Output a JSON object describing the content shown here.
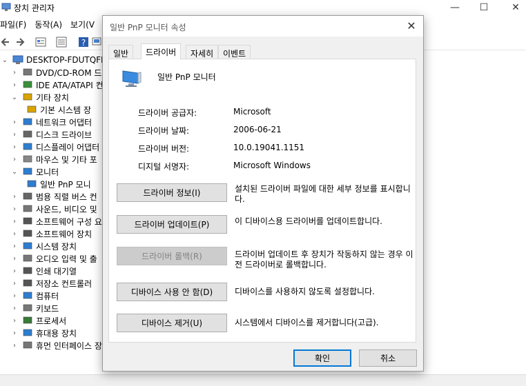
{
  "background_window": {
    "title": "장치 관리자",
    "menu": [
      "파일(F)",
      "동작(A)",
      "보기(V"
    ],
    "tree": {
      "root": "DESKTOP-FDUTQFF",
      "items": [
        {
          "label": "DVD/CD-ROM 드",
          "expanded": false
        },
        {
          "label": "IDE ATA/ATAPI 컨",
          "expanded": false
        },
        {
          "label": "기타 장치",
          "expanded": true
        },
        {
          "label": "기본 시스템 장",
          "child": true
        },
        {
          "label": "네트워크 어댑터",
          "expanded": false
        },
        {
          "label": "디스크 드라이브",
          "expanded": false
        },
        {
          "label": "디스플레이 어댑터",
          "expanded": false
        },
        {
          "label": "마우스 및 기타 포",
          "expanded": false
        },
        {
          "label": "모니터",
          "expanded": true
        },
        {
          "label": "일반 PnP 모니",
          "child": true,
          "selected": true
        },
        {
          "label": "범용 직렬 버스 컨",
          "expanded": false
        },
        {
          "label": "사운드, 비디오 및",
          "expanded": false
        },
        {
          "label": "소프트웨어 구성 요",
          "expanded": false
        },
        {
          "label": "소프트웨어 장치",
          "expanded": false
        },
        {
          "label": "시스템 장치",
          "expanded": false
        },
        {
          "label": "오디오 입력 및 출",
          "expanded": false
        },
        {
          "label": "인쇄 대기열",
          "expanded": false
        },
        {
          "label": "저장소 컨트롤러",
          "expanded": false
        },
        {
          "label": "컴퓨터",
          "expanded": false
        },
        {
          "label": "키보드",
          "expanded": false
        },
        {
          "label": "프로세서",
          "expanded": false
        },
        {
          "label": "휴대용 장치",
          "expanded": false
        },
        {
          "label": "휴먼 인터페이스 장",
          "expanded": false
        }
      ]
    }
  },
  "dialog": {
    "title": "일반 PnP 모니터 속성",
    "tabs": [
      "일반",
      "드라이버",
      "자세히",
      "이벤트"
    ],
    "active_tab": "드라이버",
    "device_name": "일반 PnP 모니터",
    "properties": [
      {
        "label": "드라이버 공급자:",
        "value": "Microsoft"
      },
      {
        "label": "드라이버 날짜:",
        "value": "2006-06-21"
      },
      {
        "label": "드라이버 버전:",
        "value": "10.0.19041.1151"
      },
      {
        "label": "디지털 서명자:",
        "value": "Microsoft Windows"
      }
    ],
    "actions": [
      {
        "button": "드라이버 정보(I)",
        "description": "설치된 드라이버 파일에 대한 세부 정보를 표시합니다.",
        "enabled": true
      },
      {
        "button": "드라이버 업데이트(P)",
        "description": "이 디바이스용 드라이버를 업데이트합니다.",
        "enabled": true
      },
      {
        "button": "드라이버 롤백(R)",
        "description": "드라이버 업데이트 후 장치가 작동하지 않는 경우 이전 드라이버로 롤백합니다.",
        "enabled": false
      },
      {
        "button": "디바이스 사용 안 함(D)",
        "description": "디바이스를 사용하지 않도록 설정합니다.",
        "enabled": true
      },
      {
        "button": "디바이스 제거(U)",
        "description": "시스템에서 디바이스를 제거합니다(고급).",
        "enabled": true
      }
    ],
    "ok_label": "확인",
    "cancel_label": "취소"
  }
}
